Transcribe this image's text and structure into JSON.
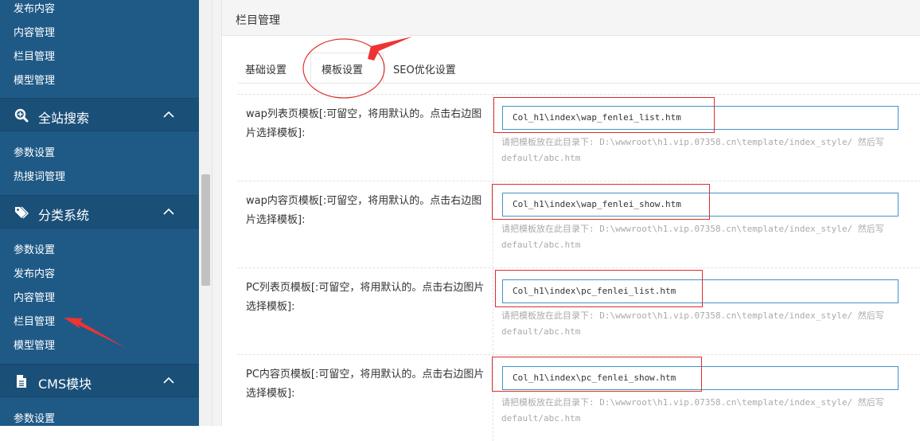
{
  "sidebar": {
    "top_items": [
      "发布内容",
      "内容管理",
      "栏目管理",
      "模型管理"
    ],
    "sections": [
      {
        "title": "全站搜索",
        "icon": "search-icon",
        "items": [
          "参数设置",
          "热搜词管理"
        ]
      },
      {
        "title": "分类系统",
        "icon": "tags-icon",
        "items": [
          "参数设置",
          "发布内容",
          "内容管理",
          "栏目管理",
          "模型管理"
        ]
      },
      {
        "title": "CMS模块",
        "icon": "file-icon",
        "items": [
          "参数设置"
        ]
      }
    ]
  },
  "panel": {
    "title": "栏目管理",
    "tabs": [
      "基础设置",
      "模板设置",
      "SEO优化设置"
    ],
    "active_tab": "模板设置"
  },
  "fields": [
    {
      "label": "wap列表页模板[:可留空，将用默认的。点击右边图片选择模板]:",
      "value": "Col_h1\\index\\wap_fenlei_list.htm",
      "hint": "请把模板放在此目录下: D:\\wwwroot\\h1.vip.07358.cn\\template/index_style/ 然后写",
      "hint2": "default/abc.htm"
    },
    {
      "label": "wap内容页模板[:可留空，将用默认的。点击右边图片选择模板]:",
      "value": "Col_h1\\index\\wap_fenlei_show.htm",
      "hint": "请把模板放在此目录下: D:\\wwwroot\\h1.vip.07358.cn\\template/index_style/ 然后写",
      "hint2": "default/abc.htm"
    },
    {
      "label": "PC列表页模板[:可留空，将用默认的。点击右边图片选择模板]:",
      "value": "Col_h1\\index\\pc_fenlei_list.htm",
      "hint": "请把模板放在此目录下: D:\\wwwroot\\h1.vip.07358.cn\\template/index_style/ 然后写",
      "hint2": "default/abc.htm"
    },
    {
      "label": "PC内容页模板[:可留空，将用默认的。点击右边图片选择模板]:",
      "value": "Col_h1\\index\\pc_fenlei_show.htm",
      "hint": "请把模板放在此目录下: D:\\wwwroot\\h1.vip.07358.cn\\template/index_style/ 然后写",
      "hint2": "default/abc.htm"
    }
  ],
  "annotation_color": "#e02c2c"
}
